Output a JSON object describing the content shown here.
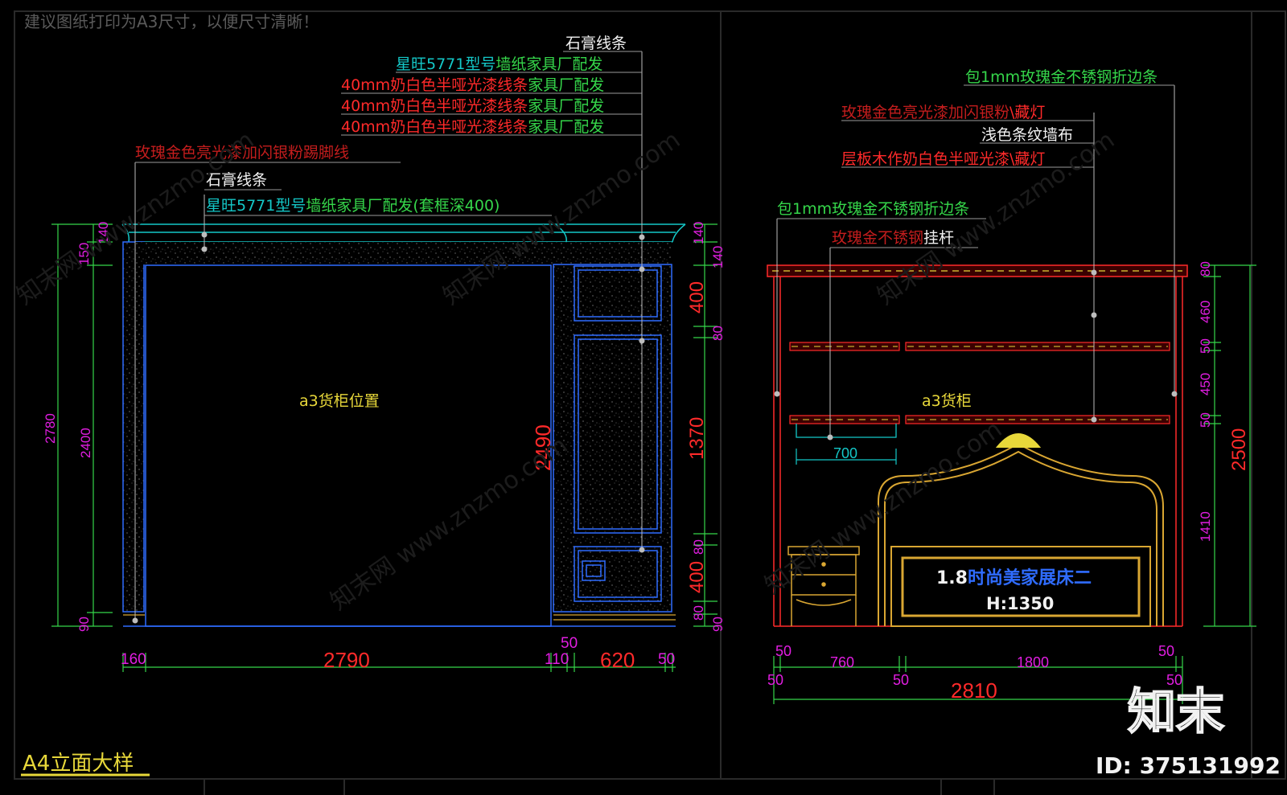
{
  "notice": "建议图纸打印为A3尺寸，以便尺寸清晰！",
  "colors": {
    "white": "#f2f2f2",
    "green": "#35d64a",
    "red": "#ff2a2a",
    "magenta": "#e21ee2",
    "cyan": "#14c8c8",
    "blue": "#2f6cff",
    "yellow": "#e8d83a",
    "gold": "#d9a632",
    "frame": "#2a2a2a"
  },
  "left_elevation": {
    "labels": {
      "gypsum_top": "石膏线条",
      "wallpaper_top_a": "星旺5771型号",
      "wallpaper_top_b": "墙纸家具厂配发",
      "molding_1_a": "40mm奶白色半哑光漆线条",
      "molding_1_b": "家具厂配发",
      "molding_2_a": "40mm奶白色半哑光漆线条",
      "molding_2_b": "家具厂配发",
      "molding_3_a": "40mm奶白色半哑光漆线条",
      "molding_3_b": "家具厂配发",
      "skirting": "玫瑰金色亮光漆加闪银粉踢脚线",
      "gypsum_left": "石膏线条",
      "wallpaper_left_a": "星旺5771型号",
      "wallpaper_left_b": "墙纸家具厂配发(套框深400)",
      "cabinet_position": "a3货柜位置"
    },
    "dims_left": {
      "d140": "140",
      "d150": "150",
      "d2780": "2780",
      "d2400": "2400",
      "d90": "90"
    },
    "dims_right": {
      "d140a": "140",
      "d140b": "140",
      "d400a": "400",
      "d80a": "80",
      "d1370": "1370",
      "d80b": "80",
      "d400b": "400",
      "d80c": "80",
      "d90": "90"
    },
    "dim_2490": "2490",
    "dims_bottom": {
      "d160": "160",
      "d2790": "2790",
      "d110": "110",
      "d50a": "50",
      "d620": "620",
      "d50b": "50"
    }
  },
  "right_elevation": {
    "labels": {
      "steel_edge_top_a": "包1mm玫瑰金不锈钢折边条",
      "rosegold_lighting_a": "玫瑰金色亮光漆加闪银粉",
      "rosegold_lighting_b": "\\藏灯",
      "striped_wallcloth": "浅色条纹墙布",
      "plywood_paint_a": "层板木作奶白色半哑光漆",
      "plywood_paint_b": "\\藏灯",
      "steel_edge_mid": "包1mm玫瑰金不锈钢折边条",
      "hanging_rod_a": "玫瑰金不锈钢",
      "hanging_rod_b": "挂杆",
      "cabinet": "a3货柜",
      "bed_name_a": "1.8",
      "bed_name_b": "时尚美家展床二",
      "bed_height": "H:1350"
    },
    "dims_right": {
      "d80": "80",
      "d460": "460",
      "d50a": "50",
      "d450": "450",
      "d50b": "50",
      "d1410": "1410",
      "d2500": "2500"
    },
    "dim_700": "700",
    "dims_bottom_top": {
      "d50a": "50",
      "d760": "760",
      "d1800": "1800",
      "d50b": "50"
    },
    "dims_bottom_low": {
      "d50a": "50",
      "d50b": "50",
      "d50c": "50",
      "d2810": "2810"
    }
  },
  "title_block": {
    "sheet_title": "A4立面大样",
    "watermark_logo": "知末",
    "id_label": "ID: 375131992",
    "watermark_text": "知末网 www.znzmo.com"
  }
}
